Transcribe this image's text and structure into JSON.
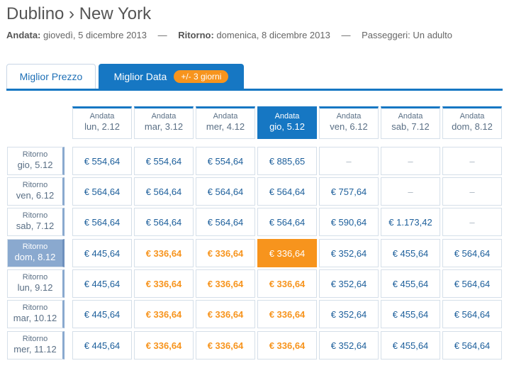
{
  "header": {
    "title": "Dublino › New York",
    "outbound_label": "Andata:",
    "outbound_value": "giovedì, 5 dicembre 2013",
    "separator": "—",
    "return_label": "Ritorno:",
    "return_value": "domenica, 8 dicembre 2013",
    "passengers": "Passeggeri: Un adulto"
  },
  "tabs": {
    "best_price": "Miglior Prezzo",
    "best_date": "Miglior Data",
    "flex_badge": "+/- 3 giorni"
  },
  "colors": {
    "accent": "#1677c3",
    "highlight": "#f7941d",
    "row_selected": "#8aa9cf"
  },
  "grid": {
    "out_label": "Andata",
    "ret_label": "Ritorno",
    "columns": [
      {
        "date": "lun, 2.12",
        "selected": false
      },
      {
        "date": "mar, 3.12",
        "selected": false
      },
      {
        "date": "mer, 4.12",
        "selected": false
      },
      {
        "date": "gio, 5.12",
        "selected": true
      },
      {
        "date": "ven, 6.12",
        "selected": false
      },
      {
        "date": "sab, 7.12",
        "selected": false
      },
      {
        "date": "dom, 8.12",
        "selected": false
      }
    ],
    "rows": [
      {
        "date": "gio, 5.12",
        "selected": false,
        "prices": [
          "€ 554,64",
          "€ 554,64",
          "€ 554,64",
          "€ 885,65",
          "–",
          "–",
          "–"
        ],
        "cheap": [
          false,
          false,
          false,
          false,
          false,
          false,
          false
        ]
      },
      {
        "date": "ven, 6.12",
        "selected": false,
        "prices": [
          "€ 564,64",
          "€ 564,64",
          "€ 564,64",
          "€ 564,64",
          "€ 757,64",
          "–",
          "–"
        ],
        "cheap": [
          false,
          false,
          false,
          false,
          false,
          false,
          false
        ]
      },
      {
        "date": "sab, 7.12",
        "selected": false,
        "prices": [
          "€ 564,64",
          "€ 564,64",
          "€ 564,64",
          "€ 564,64",
          "€ 590,64",
          "€ 1.173,42",
          "–"
        ],
        "cheap": [
          false,
          false,
          false,
          false,
          false,
          false,
          false
        ]
      },
      {
        "date": "dom, 8.12",
        "selected": true,
        "prices": [
          "€ 445,64",
          "€ 336,64",
          "€ 336,64",
          "€ 336,64",
          "€ 352,64",
          "€ 455,64",
          "€ 564,64"
        ],
        "cheap": [
          false,
          true,
          true,
          true,
          false,
          false,
          false
        ]
      },
      {
        "date": "lun, 9.12",
        "selected": false,
        "prices": [
          "€ 445,64",
          "€ 336,64",
          "€ 336,64",
          "€ 336,64",
          "€ 352,64",
          "€ 455,64",
          "€ 564,64"
        ],
        "cheap": [
          false,
          true,
          true,
          true,
          false,
          false,
          false
        ]
      },
      {
        "date": "mar, 10.12",
        "selected": false,
        "prices": [
          "€ 445,64",
          "€ 336,64",
          "€ 336,64",
          "€ 336,64",
          "€ 352,64",
          "€ 455,64",
          "€ 564,64"
        ],
        "cheap": [
          false,
          true,
          true,
          true,
          false,
          false,
          false
        ]
      },
      {
        "date": "mer, 11.12",
        "selected": false,
        "prices": [
          "€ 445,64",
          "€ 336,64",
          "€ 336,64",
          "€ 336,64",
          "€ 352,64",
          "€ 455,64",
          "€ 564,64"
        ],
        "cheap": [
          false,
          true,
          true,
          true,
          false,
          false,
          false
        ]
      }
    ]
  }
}
